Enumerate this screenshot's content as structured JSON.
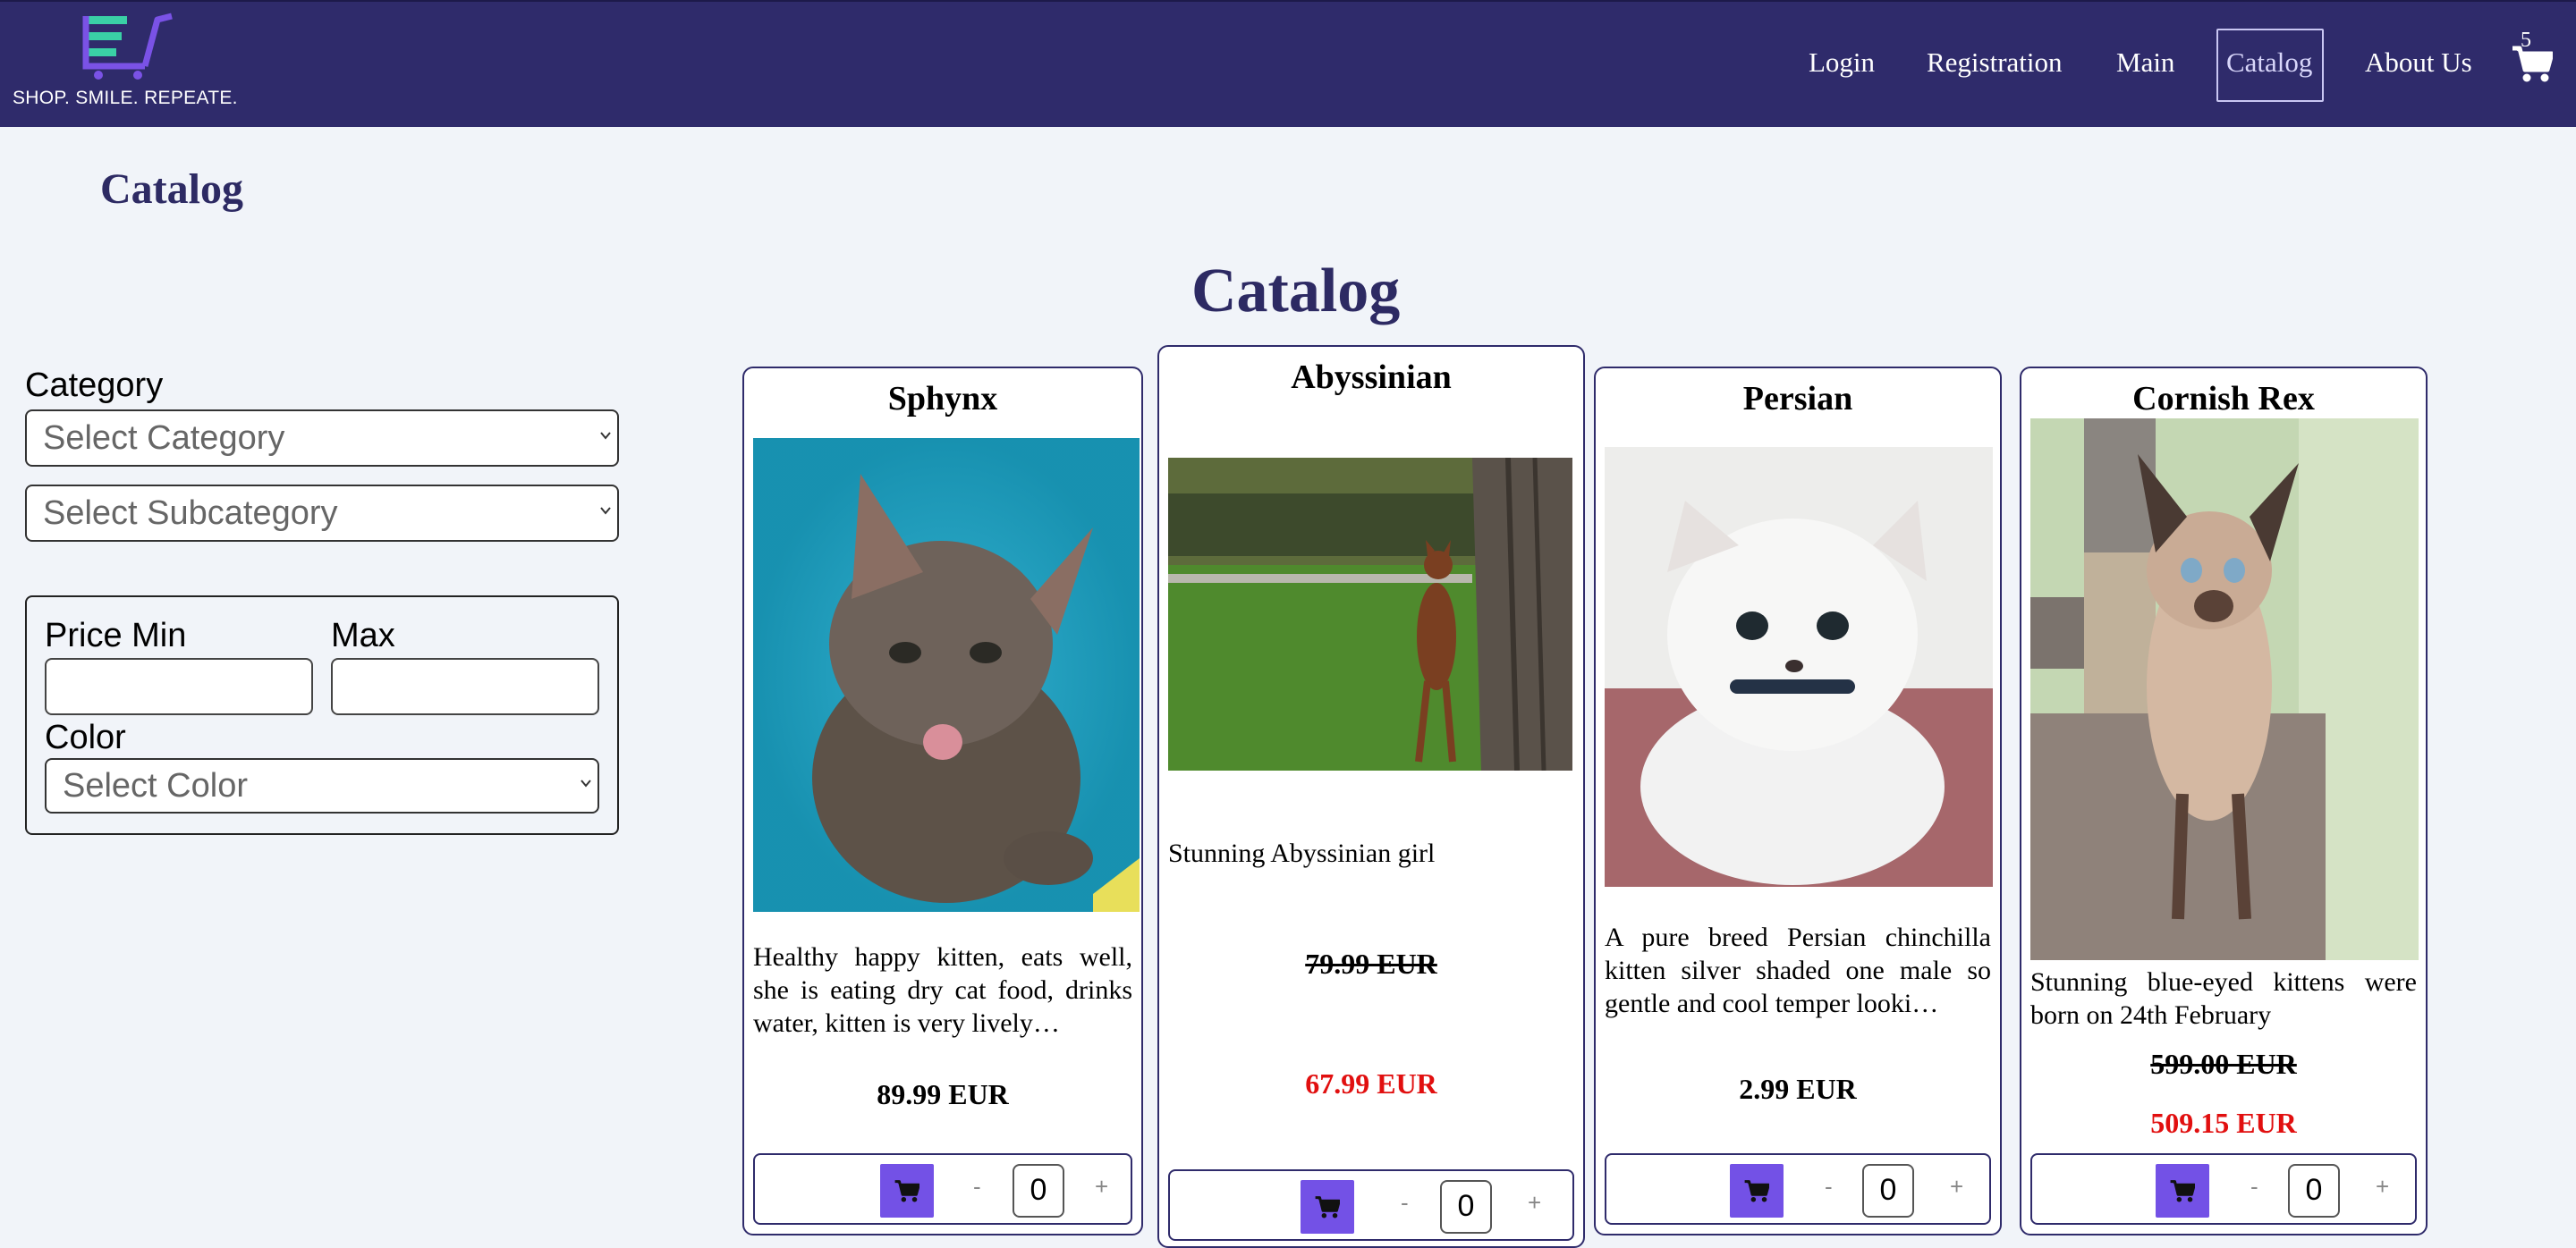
{
  "header": {
    "tagline": "SHOP. SMILE. REPEATE.",
    "nav": [
      {
        "label": "Login"
      },
      {
        "label": "Registration"
      },
      {
        "label": "Main"
      },
      {
        "label": "Catalog",
        "active": true
      },
      {
        "label": "About Us"
      }
    ],
    "cart_count": "5"
  },
  "page": {
    "breadcrumb_title": "Catalog",
    "title": "Catalog"
  },
  "filters": {
    "category_label": "Category",
    "category_placeholder": "Select Category",
    "subcategory_placeholder": "Select Subcategory",
    "price_min_label": "Price Min",
    "price_max_label": "Max",
    "color_label": "Color",
    "color_placeholder": "Select Color"
  },
  "products": [
    {
      "name": "Sphynx",
      "description": "Healthy happy kitten, eats well, she is eating dry cat food, drinks water, kitten is very lively…",
      "price": "89.99 EUR",
      "quantity": "0"
    },
    {
      "name": "Abyssinian",
      "description": "Stunning Abyssinian girl",
      "old_price": "79.99 EUR",
      "price": "67.99 EUR",
      "quantity": "0"
    },
    {
      "name": "Persian",
      "description": "A pure breed Persian chinchilla kitten silver shaded one male so gentle and cool temper looki…",
      "price": "2.99 EUR",
      "quantity": "0"
    },
    {
      "name": "Cornish Rex",
      "description": "Stunning blue-eyed kittens were born on 24th February",
      "old_price": "599.00 EUR",
      "price": "509.15 EUR",
      "quantity": "0"
    }
  ],
  "qty_controls": {
    "minus": "-",
    "plus": "+"
  },
  "icons": {
    "logo": "cart-logo-icon",
    "cart": "cart-icon",
    "add_to_cart": "cart-icon",
    "select_arrow": "chevron-down-icon"
  },
  "colors": {
    "navbar": "#2f2b6b",
    "heading": "#2d2a63",
    "accent_button": "#7351e6",
    "sale_price": "#e10f0f",
    "logo_green": "#3ad0a6",
    "logo_purple": "#7a52e6"
  }
}
